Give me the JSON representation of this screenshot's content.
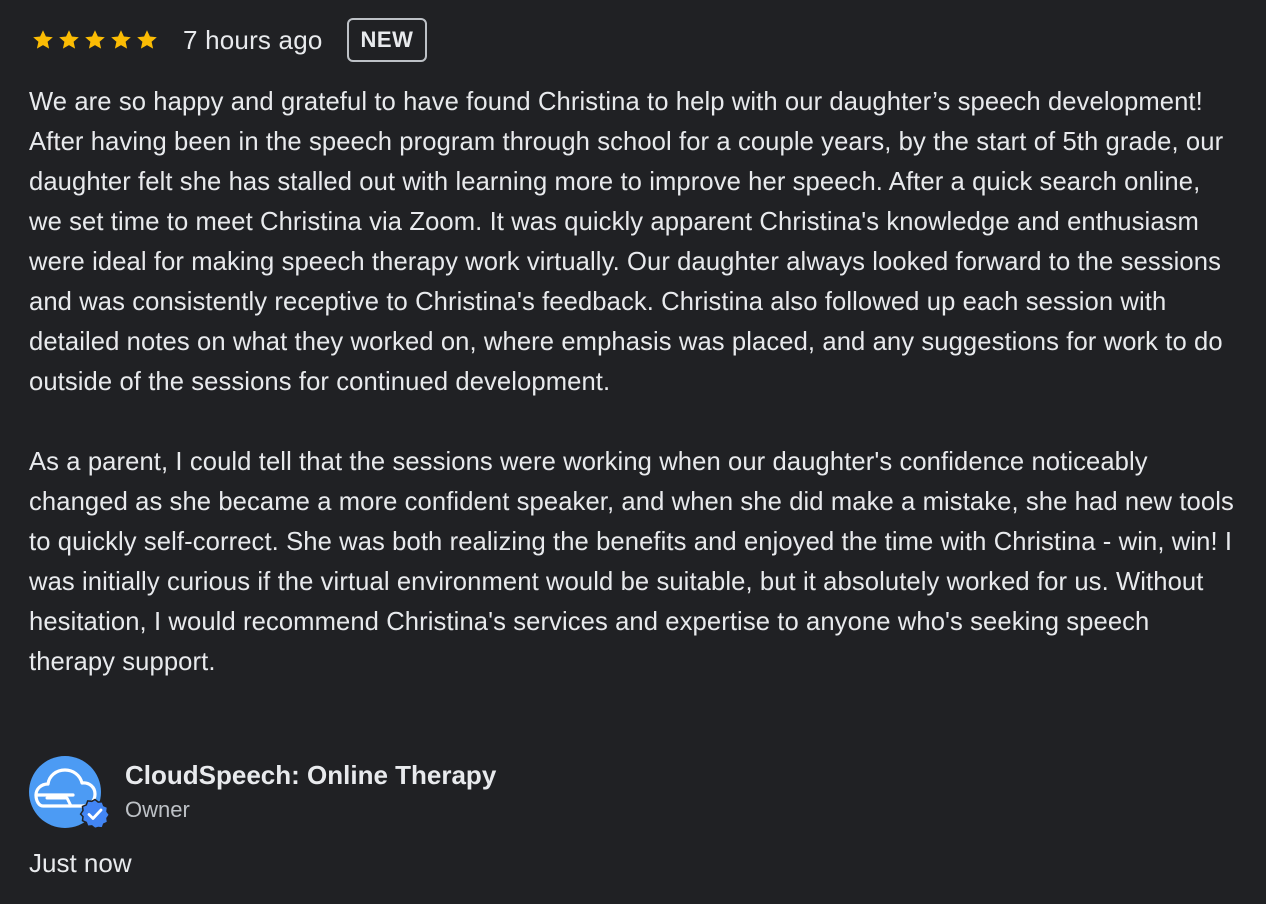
{
  "review": {
    "rating": 5,
    "max_rating": 5,
    "star_color": "#fbbc04",
    "time_ago": "7 hours ago",
    "badge": "NEW",
    "paragraphs": [
      "We are so happy and grateful to have found Christina to help with our daughter’s speech development!  After having been in the speech program through school for a couple years, by the start of 5th grade, our daughter felt she has stalled out with learning more to improve her speech. After a quick search online, we set time to meet Christina via Zoom. It was quickly apparent Christina's knowledge and enthusiasm were ideal for making speech therapy work virtually. Our daughter always looked forward to the sessions and was consistently receptive to Christina's feedback. Christina also followed up each session with detailed notes on what they worked on, where emphasis was placed, and any suggestions for work to do outside of the sessions for continued development.",
      "As a parent, I could tell that the sessions were working when our daughter's confidence noticeably changed as she became a more confident speaker, and when she did make a mistake, she had new tools to quickly self-correct. She was both realizing the benefits and enjoyed the time with Christina - win, win! I was initially curious if the virtual environment would be suitable, but it absolutely worked for us. Without hesitation, I would recommend Christina's services and expertise to anyone who's seeking speech therapy support."
    ]
  },
  "owner": {
    "name": "CloudSpeech: Online Therapy",
    "role": "Owner",
    "reply_time": "Just now",
    "avatar_icon": "cloud-icon",
    "verified_icon": "verified-badge-icon",
    "avatar_color": "#4c9bf4"
  }
}
